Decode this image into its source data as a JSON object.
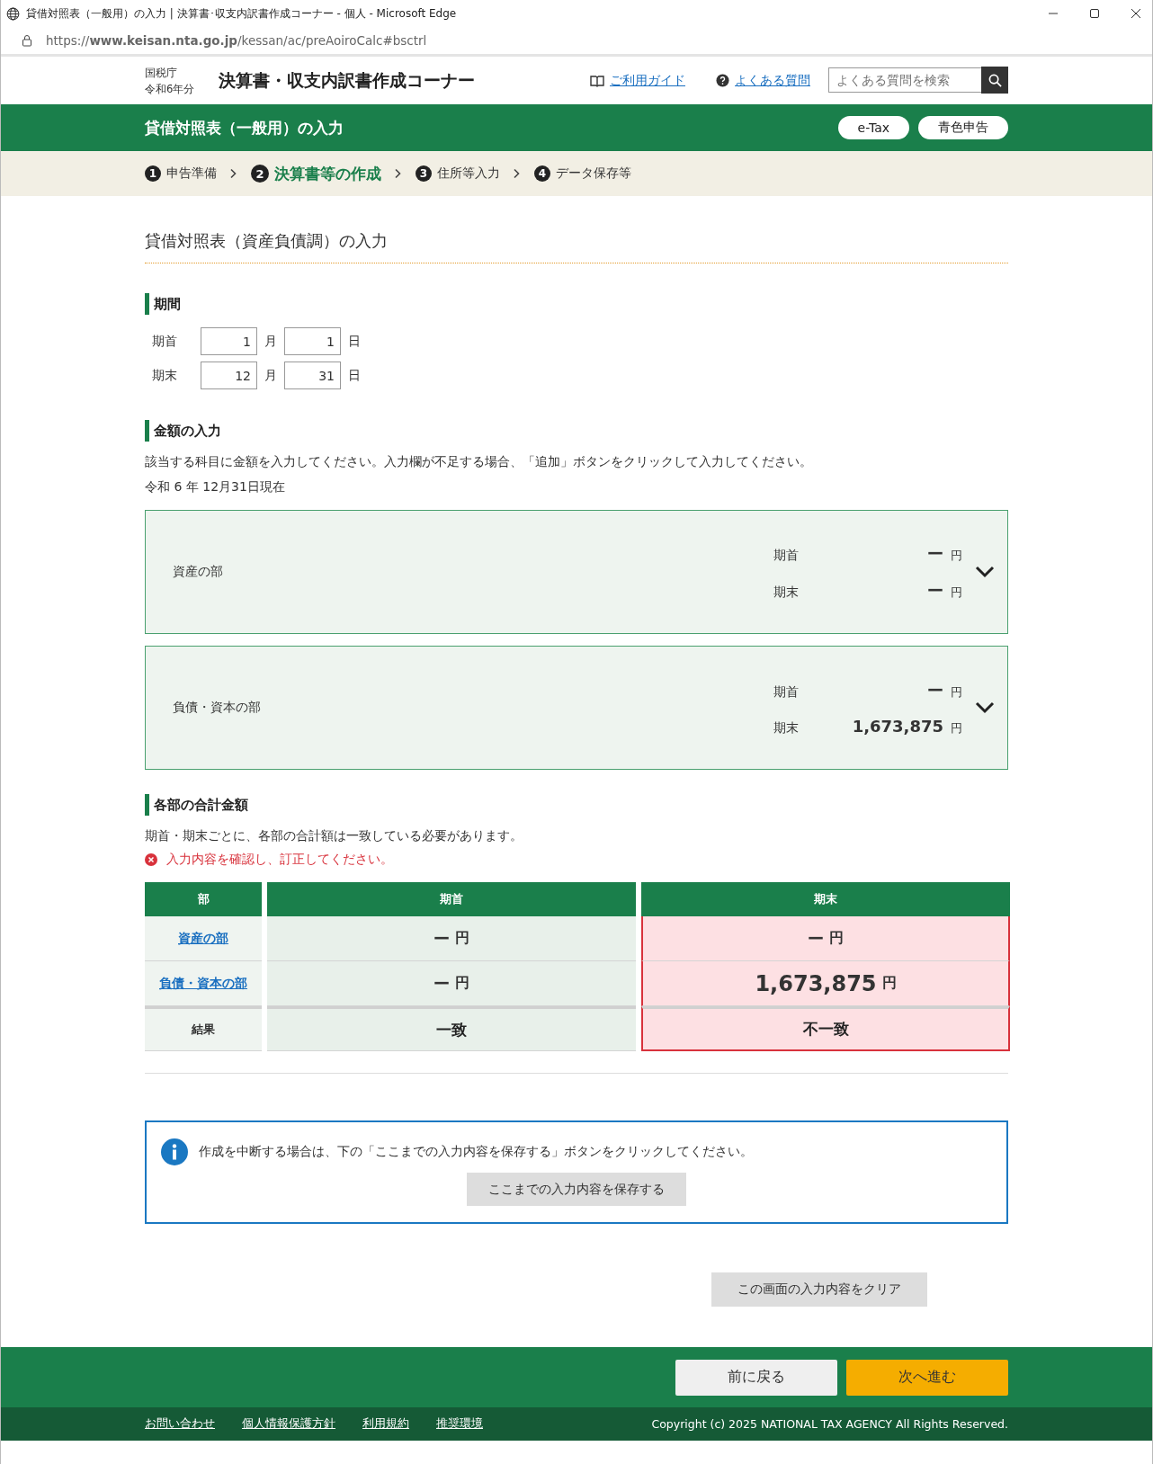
{
  "browser": {
    "title": "貸借対照表（一般用）の入力 | 決算書･収支内訳書作成コーナー - 個人 - Microsoft Edge",
    "url": "https://**www.keisan.nta.go.jp**/kessan/ac/preAoiroCalc#bsctrl"
  },
  "header": {
    "agency": "国税庁",
    "year": "令和6年分",
    "site_title": "決算書・収支内訳書作成コーナー",
    "links": [
      {
        "kind": "guide",
        "label": "ご利用ガイド"
      },
      {
        "kind": "faq",
        "label": "よくある質問"
      }
    ],
    "search": {
      "placeholder": "よくある質問を検索"
    }
  },
  "page_bar": {
    "title": "貸借対照表（一般用）の入力",
    "buttons": [
      "e-Tax",
      "青色申告"
    ]
  },
  "steps": [
    {
      "number": "1",
      "label": "申告準備",
      "selected": false
    },
    {
      "number": "2",
      "label": "決算書等の作成",
      "selected": true
    },
    {
      "number": "3",
      "label": "住所等入力",
      "selected": false
    },
    {
      "number": "4",
      "label": "データ保存等",
      "selected": false
    }
  ],
  "heading": "貸借対照表（資産負債調）の入力",
  "period": {
    "heading": "期間",
    "rows": [
      {
        "label": "期首",
        "month": "1",
        "month_unit": "月",
        "day": "1",
        "day_unit": "日"
      },
      {
        "label": "期末",
        "month": "12",
        "month_unit": "月",
        "day": "31",
        "day_unit": "日"
      }
    ]
  },
  "amounts": {
    "heading": "金額の入力",
    "note": "該当する科目に金額を入力してください。入力欄が不足する場合、「追加」ボタンをクリックして入力してください。",
    "as_of": "令和 6 年 12月31日現在",
    "panels": [
      {
        "title": "資産の部",
        "expanded": false,
        "rows": [
          {
            "label": "期首",
            "amount": "ー",
            "unit": "円"
          },
          {
            "label": "期末",
            "amount": "ー",
            "unit": "円"
          }
        ]
      },
      {
        "title": "負債・資本の部",
        "expanded": false,
        "rows": [
          {
            "label": "期首",
            "amount": "ー",
            "unit": "円"
          },
          {
            "label": "期末",
            "amount": "1,673,875",
            "unit": "円"
          }
        ]
      }
    ]
  },
  "totals": {
    "heading": "各部の合計金額",
    "note": "期首・期末ごとに、各部の合計額は一致している必要があります。",
    "error": "入力内容を確認し、訂正してください。",
    "columns": [
      {
        "label": "部"
      },
      {
        "label": "期首",
        "error": false
      },
      {
        "label": "期末",
        "error": true
      }
    ],
    "rows": [
      {
        "kind": "link",
        "cells": [
          {
            "text": "資産の部"
          },
          {
            "amount": "ー",
            "unit": "円"
          },
          {
            "amount": "ー",
            "unit": "円"
          }
        ]
      },
      {
        "kind": "link",
        "cells": [
          {
            "text": "負債・資本の部"
          },
          {
            "amount": "ー",
            "unit": "円"
          },
          {
            "amount": "1,673,875",
            "unit": "円"
          }
        ]
      },
      {
        "kind": "result",
        "cells": [
          {
            "text": "結果"
          },
          {
            "text": "一致"
          },
          {
            "text": "不一致"
          }
        ]
      }
    ]
  },
  "info": {
    "message": "作成を中断する場合は、下の「ここまでの入力内容を保存する」ボタンをクリックしてください。",
    "button": "ここまでの入力内容を保存する"
  },
  "clear_button": "この画面の入力内容をクリア",
  "nav": {
    "back": "前に戻る",
    "next": "次へ進む"
  },
  "footer": {
    "links": [
      "お問い合わせ",
      "個人情報保護方針",
      "利用規約",
      "推奨環境"
    ],
    "copyright": "Copyright (c) 2025 NATIONAL TAX AGENCY All Rights Reserved."
  }
}
